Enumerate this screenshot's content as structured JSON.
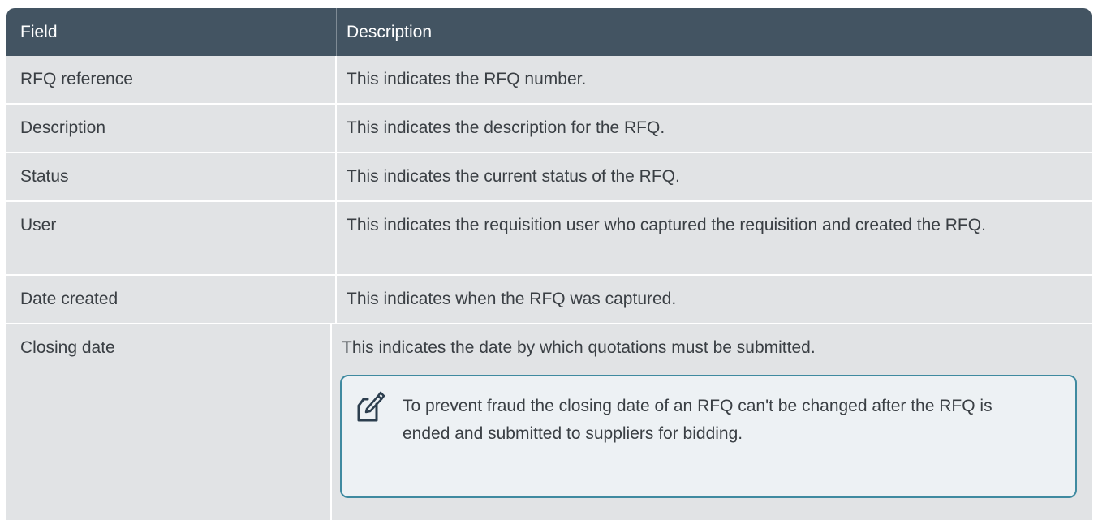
{
  "table": {
    "headers": {
      "field": "Field",
      "description": "Description"
    },
    "rows": [
      {
        "field": "RFQ reference",
        "description": "This indicates the RFQ number."
      },
      {
        "field": "Description",
        "description": "This indicates the description for the RFQ."
      },
      {
        "field": "Status",
        "description": "This indicates the current status of the RFQ."
      },
      {
        "field": "User",
        "description": "This indicates the requisition user who captured the requisition and created the RFQ."
      },
      {
        "field": "Date created",
        "description": "This indicates when the RFQ was captured."
      },
      {
        "field": "Closing date",
        "description": "This indicates the date by which quotations must be submitted."
      }
    ],
    "note": {
      "icon": "note-edit-icon",
      "text": "To prevent fraud the closing date of an RFQ can't be changed after the RFQ is ended and submitted to suppliers for bidding."
    }
  },
  "colors": {
    "header_bg": "#435462",
    "row_bg": "#e1e3e5",
    "note_border": "#3f8aa0",
    "note_bg": "#edf1f4",
    "text": "#3a3f44"
  }
}
